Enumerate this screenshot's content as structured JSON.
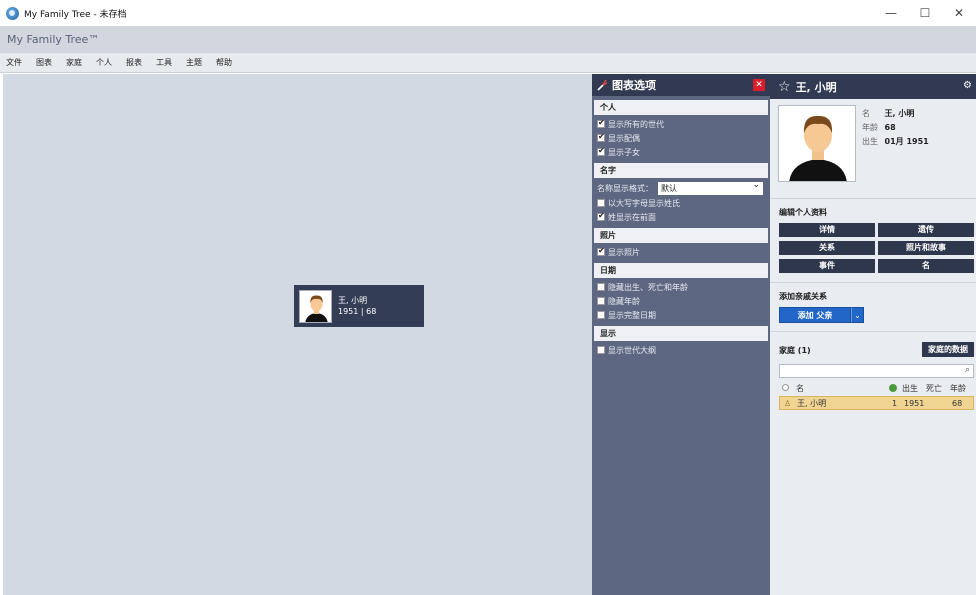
{
  "window": {
    "title": "My Family Tree - 未存档",
    "controls": {
      "minimize": "—",
      "maximize": "☐",
      "close": "✕"
    }
  },
  "appbar": {
    "brand": "My Family Tree™"
  },
  "menu": [
    "文件",
    "图表",
    "家庭",
    "个人",
    "报表",
    "工具",
    "主题",
    "帮助"
  ],
  "canvas": {
    "person": {
      "name": "王, 小明",
      "line2": "1951 | 68"
    }
  },
  "chart_options": {
    "title": "图表选项",
    "close": "✕",
    "sections": {
      "person": {
        "header": "个人",
        "options": [
          {
            "label": "显示所有的世代",
            "checked": true
          },
          {
            "label": "显示配偶",
            "checked": true
          },
          {
            "label": "显示子女",
            "checked": true
          }
        ]
      },
      "name": {
        "header": "名字",
        "format_label": "名称显示格式：",
        "format_value": "默认",
        "options": [
          {
            "label": "以大写字母显示姓氏",
            "checked": false
          },
          {
            "label": "姓显示在前面",
            "checked": true
          }
        ]
      },
      "photo": {
        "header": "照片",
        "options": [
          {
            "label": "显示照片",
            "checked": true
          }
        ]
      },
      "date": {
        "header": "日期",
        "options": [
          {
            "label": "隐藏出生、死亡和年龄",
            "checked": false
          },
          {
            "label": "隐藏年龄",
            "checked": false
          },
          {
            "label": "显示完整日期",
            "checked": false
          }
        ]
      },
      "display": {
        "header": "显示",
        "options": [
          {
            "label": "显示世代大纲",
            "checked": false
          }
        ]
      }
    }
  },
  "person_panel": {
    "star": "☆",
    "name": "王, 小明",
    "gear": "⚙",
    "facts": {
      "name_label": "名",
      "name_value": "王, 小明",
      "age_label": "年龄",
      "age_value": "68",
      "birth_label": "出生",
      "birth_value": "01月 1951"
    },
    "edit_title": "编辑个人资料",
    "edit_buttons": [
      "详情",
      "遗传",
      "关系",
      "照片和故事",
      "事件",
      "名"
    ],
    "add_title": "添加亲戚关系",
    "add_button": "添加 父亲",
    "add_dropdown": "⌄",
    "family_title": "家庭 (1)",
    "family_data_button": "家庭的数据",
    "search_placeholder": "",
    "search_icon": "⌕",
    "columns": {
      "name": "名",
      "birth": "出生",
      "death": "死亡",
      "age": "年龄"
    },
    "rows": [
      {
        "name": "王, 小明",
        "count": "1",
        "birth": "1951",
        "death": "",
        "age": "68"
      }
    ]
  },
  "colors": {
    "dark_panel": "#313a52",
    "options_bg": "#5e6781",
    "canvas_bg": "#d3d9e2",
    "accent_blue": "#2267c7",
    "close_red": "#d81e2c",
    "row_highlight": "#f0d592"
  },
  "icons": [
    "app-logo-icon",
    "wrench-icon",
    "close-icon",
    "star-icon",
    "gear-icon",
    "search-icon",
    "radio-icon",
    "tree-icon",
    "person-icon",
    "chevron-down-icon"
  ]
}
